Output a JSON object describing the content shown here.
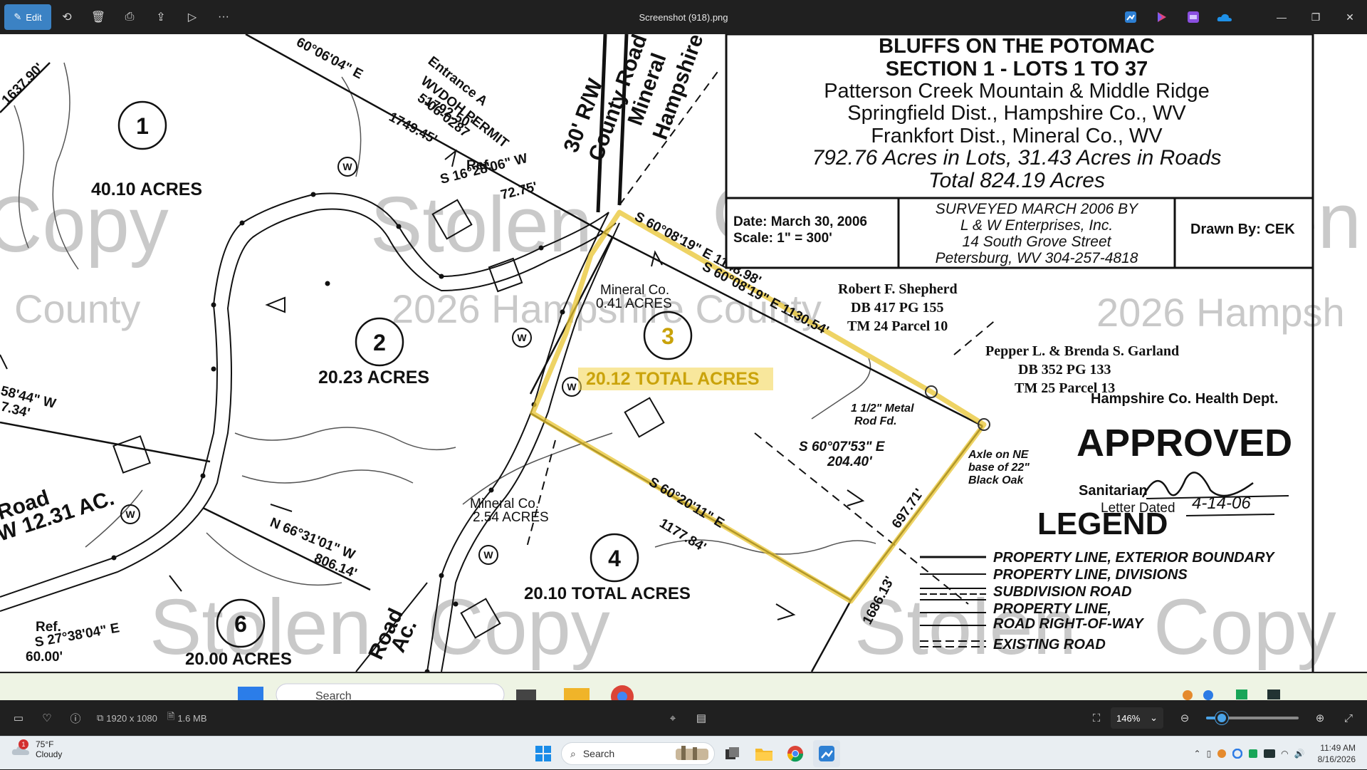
{
  "toolbar": {
    "edit_label": "Edit",
    "file_title": "Screenshot (918).png"
  },
  "survey": {
    "title_block": {
      "line1": "BLUFFS ON THE POTOMAC",
      "line2": "SECTION 1 - LOTS 1 TO 37",
      "line3": "Patterson Creek Mountain & Middle Ridge",
      "line4": "Springfield Dist., Hampshire Co., WV",
      "line5": "Frankfort Dist., Mineral Co., WV",
      "line6": "792.76 Acres in Lots, 31.43 Acres in Roads",
      "line7": "Total 824.19 Acres"
    },
    "info": {
      "date": "Date:  March 30, 2006",
      "scale": "Scale:  1\" = 300'",
      "surveyed1": "SURVEYED MARCH 2006 BY",
      "surveyed2": "L & W Enterprises, Inc.",
      "surveyed3": "14 South Grove Street",
      "surveyed4": "Petersburg, WV 304-257-4818",
      "drawn": "Drawn By: CEK"
    },
    "owners": {
      "shepherd1": "Robert F. Shepherd",
      "shepherd2": "DB 417 PG 155",
      "shepherd3": "TM 24 Parcel 10",
      "garland1": "Pepper L. & Brenda S. Garland",
      "garland2": "DB 352 PG 133",
      "garland3": "TM 25 Parcel 13",
      "health": "Hampshire Co. Health Dept."
    },
    "approval": {
      "approved": "APPROVED",
      "sanitarian": "Sanitarian",
      "letter_dated": "Letter Dated",
      "date_handwritten": "4-14-06"
    },
    "legend": {
      "title": "LEGEND",
      "items": [
        "PROPERTY LINE, EXTERIOR BOUNDARY",
        "PROPERTY LINE, DIVISIONS",
        "SUBDIVISION ROAD",
        "PROPERTY LINE,",
        "ROAD RIGHT-OF-WAY",
        "EXISTING ROAD"
      ]
    },
    "lots": {
      "lot1": "1",
      "lot1_acres": "40.10 ACRES",
      "lot2": "2",
      "lot2_acres": "20.23 ACRES",
      "lot3": "3",
      "lot3_acres": "20.12 TOTAL ACRES",
      "lot4": "4",
      "lot4_acres": "20.10 TOTAL ACRES",
      "lot6": "6",
      "mineral1": "Mineral Co.",
      "mineral1_acres": "0.41 ACRES",
      "mineral2": "Mineral Co.",
      "mineral2_acres": "2.54 ACRES",
      "road_left": "Road",
      "road_left2": "W 12.31 AC.",
      "road_bottom": "Road",
      "road_bottom2": "Ac.",
      "acres_bottom": "20.00 ACRES"
    },
    "bearings": {
      "b1": "S 60°08'19\" E 1148.98'",
      "b2": "S 60°08'19\" E 1130.54'",
      "b3": "S 60°07'53\" E",
      "b3b": "204.40'",
      "b4": "S 60°20'11\" E",
      "b5": "1177.84'",
      "b6": "697.71'",
      "b7": "1686.13'",
      "b8": "N 66°31'01\" W",
      "b9": "806.14'",
      "b10": "S 16°28'06\" W",
      "b11": "72.75'",
      "b12": "Ref.",
      "b13": "60°06'04\" E",
      "b14": "1792.50'",
      "b15": "1749.45'",
      "b16": "1637.90'",
      "b17": "S 27°38'04\" E",
      "b18": "60.00'",
      "b19": "Ref.",
      "b20": "58'44\" W",
      "b21": "7.34'",
      "entrance": "Entrance A",
      "wvdoh": "WVDOH PERMIT",
      "permit": "5-06-0287",
      "county_road1": "30' R/W",
      "county_road2": "County Road",
      "county_road3": "Mineral",
      "county_road4": "Hampshire",
      "rod": "1 1/2\" Metal",
      "rod2": "Rod Fd.",
      "axle1": "Axle on NE",
      "axle2": "base of 22\"",
      "axle3": "Black Oak"
    },
    "watermarks": {
      "copy": "Copy",
      "stolen": "Stolen",
      "county": "County",
      "hampshire": "2026 Hampshire County",
      "hampsh": "2026 Hampsh"
    }
  },
  "statusbar": {
    "dimensions": "1920 x 1080",
    "filesize": "1.6 MB",
    "zoom": "146%",
    "zoom_fraction": 0.17
  },
  "taskbar": {
    "temp": "75°F",
    "condition": "Cloudy",
    "weather_badge": "1",
    "search": "Search",
    "embedded_search": "Search",
    "time": "11:49 AM",
    "date": "8/16/2026"
  }
}
